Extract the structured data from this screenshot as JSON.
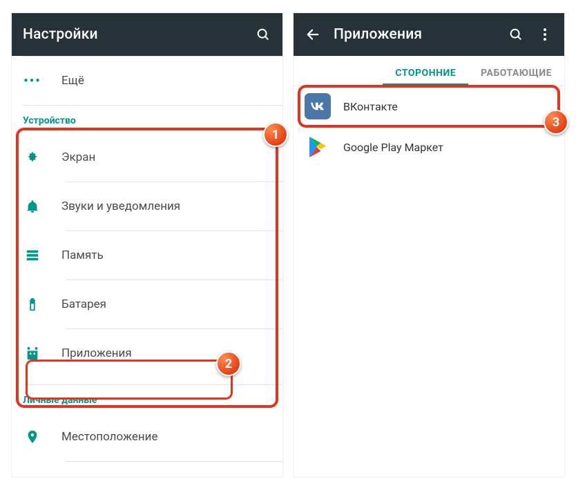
{
  "left": {
    "title": "Настройки",
    "more": "Ещё",
    "section_device": "Устройство",
    "items": {
      "screen": "Экран",
      "sounds": "Звуки и уведомления",
      "memory": "Память",
      "battery": "Батарея",
      "apps": "Приложения"
    },
    "section_personal": "Личные данные",
    "items2": {
      "location": "Местоположение"
    }
  },
  "right": {
    "title": "Приложения",
    "tabs": {
      "third_party": "СТОРОННИЕ",
      "running": "РАБОТАЮЩИЕ"
    },
    "apps": {
      "vk": "ВКонтакте",
      "play": "Google Play Маркет"
    }
  },
  "badges": {
    "b1": "1",
    "b2": "2",
    "b3": "3"
  }
}
